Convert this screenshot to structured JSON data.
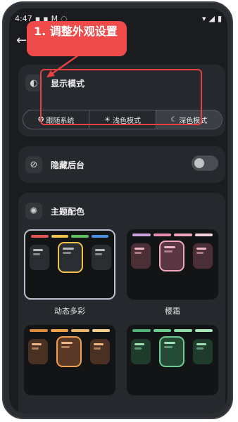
{
  "status_bar": {
    "time": "4:47",
    "wifi_icon": "wifi-icon",
    "battery_icon": "battery-icon"
  },
  "nav": {
    "back_icon": "arrow-left-icon"
  },
  "annotation": {
    "text": "1. 调整外观设置",
    "color": "#ef4b4b"
  },
  "display_mode": {
    "title": "显示模式",
    "options": [
      {
        "label": "跟随系统",
        "icon": "auto-icon",
        "selected": false
      },
      {
        "label": "浅色模式",
        "icon": "sun-icon",
        "selected": false
      },
      {
        "label": "深色模式",
        "icon": "moon-icon",
        "selected": true
      }
    ]
  },
  "hide_background": {
    "title": "隐藏后台",
    "icon": "eye-off-icon",
    "enabled": false
  },
  "theme": {
    "title": "主题配色",
    "icon": "palette-icon",
    "themes": [
      {
        "name": "动态多彩",
        "selected": true,
        "colors": [
          "#e25555",
          "#f0c24a",
          "#5cc05c",
          "#4a8fe0"
        ],
        "card_color": "#2e3136",
        "accent": "#f0c24a"
      },
      {
        "name": "樱霜",
        "selected": false,
        "colors": [
          "#c8a2d8",
          "#e58fb0",
          "#f0a6bd",
          "#f4d2dc"
        ],
        "card_color": "#4a2f37",
        "accent": "#f0a6bd"
      },
      {
        "name": "",
        "selected": false,
        "colors": [
          "#d98a3c",
          "#f0a04a",
          "#e8b86a",
          "#f2cf8f"
        ],
        "card_color": "#4a3022",
        "accent": "#f0a04a"
      },
      {
        "name": "",
        "selected": false,
        "colors": [
          "#4fb07a",
          "#6ccf8f",
          "#8fdaa5",
          "#a9e6b8"
        ],
        "card_color": "#1f3b2c",
        "accent": "#6ccf8f"
      }
    ]
  }
}
